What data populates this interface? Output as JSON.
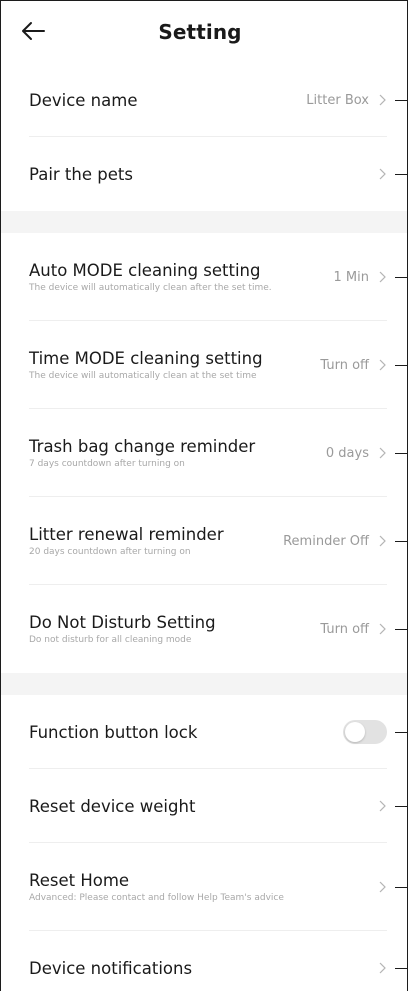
{
  "header": {
    "title": "Setting",
    "back_icon": "arrow-left-icon"
  },
  "section1": [
    {
      "label": "Device name",
      "value": "Litter Box"
    },
    {
      "label": "Pair the pets",
      "value": ""
    }
  ],
  "section2": [
    {
      "label": "Auto MODE cleaning setting",
      "sub": "The device will automatically clean after the set time.",
      "value": "1 Min"
    },
    {
      "label": "Time MODE cleaning setting",
      "sub": "The device will automatically clean at the set time",
      "value": "Turn off"
    },
    {
      "label": "Trash bag change reminder",
      "sub": "7 days countdown after turning on",
      "value": "0 days"
    },
    {
      "label": "Litter renewal reminder",
      "sub": "20 days countdown after turning on",
      "value": "Reminder Off"
    },
    {
      "label": "Do Not Disturb Setting",
      "sub": "Do not disturb for all cleaning mode",
      "value": "Turn off"
    }
  ],
  "section3": [
    {
      "label": "Function button lock",
      "toggle_on": false
    },
    {
      "label": "Reset device weight"
    },
    {
      "label": "Reset Home",
      "sub": "Advanced: Please contact and follow Help Team's advice"
    },
    {
      "label": "Device notifications"
    }
  ],
  "colors": {
    "text": "#1a1a1a",
    "value": "#9a9a9a",
    "sub": "#a8a8a8",
    "section_gap": "#f4f4f4",
    "toggle_off": "#e2e2e2"
  },
  "icons": {
    "chevron": "chevron-right-icon",
    "back": "arrow-left-icon"
  }
}
